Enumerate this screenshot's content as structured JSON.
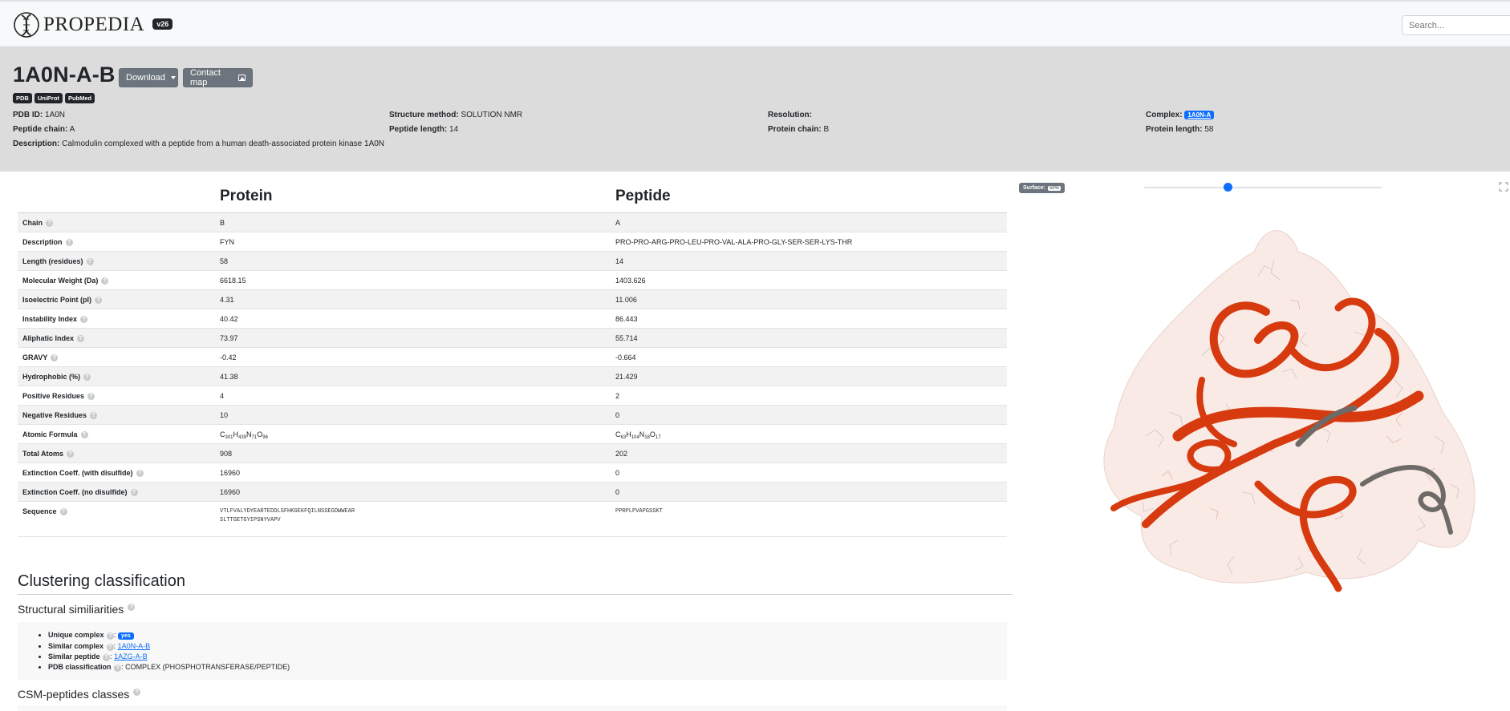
{
  "nav": {
    "brand": "PROPEDIA",
    "version": "v26",
    "search_placeholder": "Search..."
  },
  "header": {
    "title": "1A0N-A-B",
    "download_label": "Download",
    "contact_map_label": "Contact map",
    "badges": [
      "PDB",
      "UniProt",
      "PubMed"
    ],
    "meta": {
      "pdb_id_label": "PDB ID:",
      "pdb_id": "1A0N",
      "structure_method_label": "Structure method:",
      "structure_method": "SOLUTION NMR",
      "resolution_label": "Resolution:",
      "resolution": "",
      "complex_label": "Complex:",
      "complex": "1A0N-A",
      "peptide_chain_label": "Peptide chain:",
      "peptide_chain": "A",
      "peptide_length_label": "Peptide length:",
      "peptide_length": "14",
      "protein_chain_label": "Protein chain:",
      "protein_chain": "B",
      "protein_length_label": "Protein length:",
      "protein_length": "58",
      "description_label": "Description:",
      "description": "Calmodulin complexed with a peptide from a human death-associated protein kinase 1A0N"
    }
  },
  "table": {
    "col_protein": "Protein",
    "col_peptide": "Peptide",
    "rows": [
      {
        "label": "Chain",
        "protein": "B",
        "peptide": "A"
      },
      {
        "label": "Description",
        "protein": "FYN",
        "peptide": "PRO-PRO-ARG-PRO-LEU-PRO-VAL-ALA-PRO-GLY-SER-SER-LYS-THR"
      },
      {
        "label": "Length (residues)",
        "protein": "58",
        "peptide": "14"
      },
      {
        "label": "Molecular Weight (Da)",
        "protein": "6618.15",
        "peptide": "1403.626"
      },
      {
        "label": "Isoelectric Point (pI)",
        "protein": "4.31",
        "peptide": "11.006"
      },
      {
        "label": "Instability Index",
        "protein": "40.42",
        "peptide": "86.443"
      },
      {
        "label": "Aliphatic Index",
        "protein": "73.97",
        "peptide": "55.714"
      },
      {
        "label": "GRAVY",
        "protein": "-0.42",
        "peptide": "-0.664"
      },
      {
        "label": "Hydrophobic (%)",
        "protein": "41.38",
        "peptide": "21.429"
      },
      {
        "label": "Positive Residues",
        "protein": "4",
        "peptide": "2"
      },
      {
        "label": "Negative Residues",
        "protein": "10",
        "peptide": "0"
      },
      {
        "label": "Atomic Formula",
        "protein": "",
        "peptide": ""
      },
      {
        "label": "Total Atoms",
        "protein": "908",
        "peptide": "202"
      },
      {
        "label": "Extinction Coeff. (with disulfide)",
        "protein": "16960",
        "peptide": "0"
      },
      {
        "label": "Extinction Coeff. (no disulfide)",
        "protein": "16960",
        "peptide": "0"
      },
      {
        "label": "Sequence",
        "protein": "",
        "peptide": ""
      }
    ],
    "formula_protein": {
      "C": "C",
      "c": "301",
      "H": "H",
      "h": "439",
      "N": "N",
      "n": "71",
      "O": "O",
      "o": "96"
    },
    "formula_peptide": {
      "C": "C",
      "c": "63",
      "H": "H",
      "h": "104",
      "N": "N",
      "n": "18",
      "O": "O",
      "o": "17"
    },
    "sequence_protein_line1": "VTLFVALYDYEARTEDDLSFHKGEKFQILNSSEGDWWEAR",
    "sequence_protein_line2": "SLTTGETGYIPSNYVAPV",
    "sequence_peptide": "PPRPLPVAPGSSKT"
  },
  "clustering": {
    "title": "Clustering classification",
    "structural_title": "Structural similiarities",
    "unique_label": "Unique complex",
    "unique_value": "yes",
    "similar_complex_label": "Similar complex",
    "similar_complex_value": "1A0N-A-B",
    "similar_peptide_label": "Similar peptide",
    "similar_peptide_value": "1AZG-A-B",
    "pdb_class_label": "PDB classification",
    "pdb_class_value": "COMPLEX (PHOSPHOTRANSFERASE/PEPTIDE)",
    "csm_title": "CSM-peptides classes"
  },
  "viewer": {
    "surface_label": "Surface:",
    "surface_pct": "50%",
    "surface_level": 0.35,
    "protein_color": "#d63a0e",
    "peptide_color": "#6e6a67",
    "surface_color": "#f4d8cf"
  }
}
